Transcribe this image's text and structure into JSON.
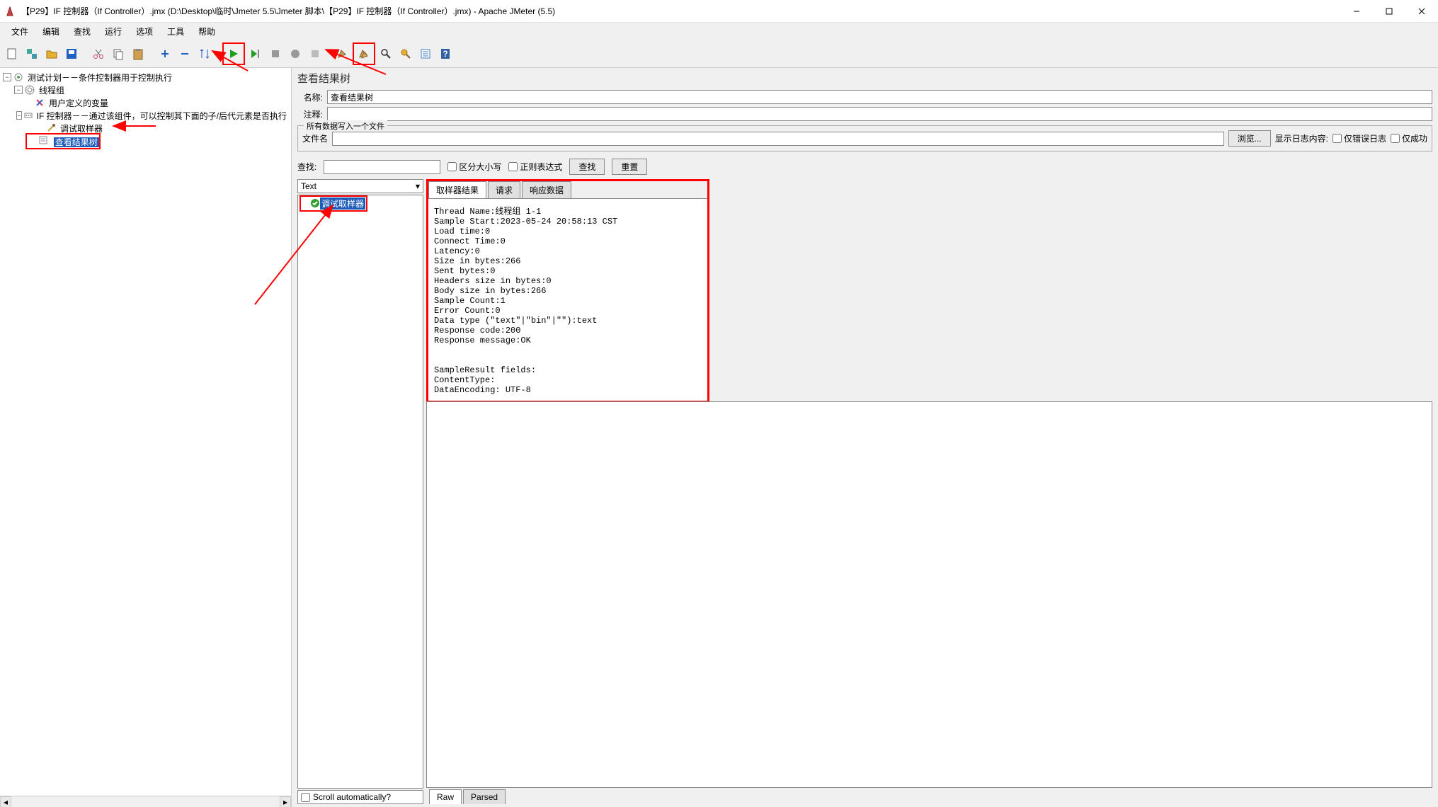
{
  "window": {
    "title": "【P29】IF 控制器（If Controller）.jmx (D:\\Desktop\\临时\\Jmeter 5.5\\Jmeter 脚本\\【P29】IF 控制器（If Controller）.jmx) - Apache JMeter (5.5)"
  },
  "menu": {
    "file": "文件",
    "edit": "编辑",
    "search": "查找",
    "run": "运行",
    "options": "选项",
    "tools": "工具",
    "help": "帮助"
  },
  "tree": {
    "testplan": "测试计划－－条件控制器用于控制执行",
    "threadgroup": "线程组",
    "uservars": "用户定义的变量",
    "ifcontroller": "IF 控制器－－通过该组件，可以控制其下面的子/后代元素是否执行",
    "debugsampler": "调试取样器",
    "resultstree": "查看结果树"
  },
  "panel": {
    "header": "查看结果树",
    "name_label": "名称:",
    "name_value": "查看结果树",
    "comment_label": "注释:",
    "file_fieldset": "所有数据写入一个文件",
    "filename_label": "文件名",
    "browse": "浏览...",
    "showlog": "显示日志内容:",
    "erroronly": "仅错误日志",
    "successonly": "仅成功",
    "search_label": "查找:",
    "case_sensitive": "区分大小写",
    "regex": "正则表达式",
    "search_btn": "查找",
    "reset_btn": "重置",
    "renderer": "Text",
    "scroll_auto": "Scroll automatically?",
    "tabs": {
      "sampler": "取样器结果",
      "request": "请求",
      "response": "响应数据"
    },
    "bottom_tabs": {
      "raw": "Raw",
      "parsed": "Parsed"
    },
    "result_item": "调试取样器",
    "sample_output": "Thread Name:线程组 1-1\nSample Start:2023-05-24 20:58:13 CST\nLoad time:0\nConnect Time:0\nLatency:0\nSize in bytes:266\nSent bytes:0\nHeaders size in bytes:0\nBody size in bytes:266\nSample Count:1\nError Count:0\nData type (\"text\"|\"bin\"|\"\"):text\nResponse code:200\nResponse message:OK\n\n\nSampleResult fields:\nContentType: \nDataEncoding: UTF-8"
  }
}
